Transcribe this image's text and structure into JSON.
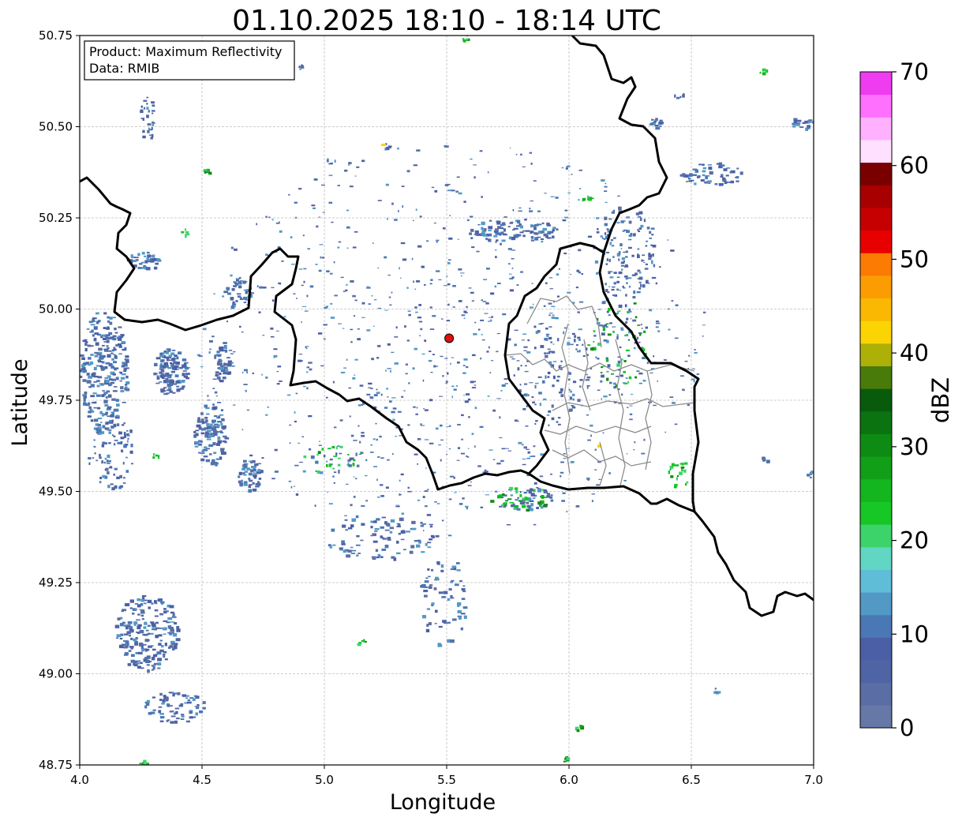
{
  "title": "01.10.2025 18:10 - 18:14 UTC",
  "info_box": {
    "line1": "Product: Maximum Reflectivity",
    "line2": "Data: RMIB"
  },
  "axes": {
    "xlabel": "Longitude",
    "ylabel": "Latitude",
    "xlim": [
      4.0,
      7.0
    ],
    "ylim": [
      48.75,
      50.75
    ],
    "xticks": [
      "4.0",
      "4.5",
      "5.0",
      "5.5",
      "6.0",
      "6.5",
      "7.0"
    ],
    "yticks": [
      "50.75",
      "50.50",
      "50.25",
      "50.00",
      "49.75",
      "49.50",
      "49.25",
      "49.00",
      "48.75"
    ],
    "grid": true
  },
  "radar_site": {
    "lon": 5.51,
    "lat": 49.92
  },
  "colorbar": {
    "label": "dBZ",
    "ticks": [
      "0",
      "10",
      "20",
      "30",
      "40",
      "50",
      "60",
      "70"
    ],
    "colors": [
      "#6678a8",
      "#5a6ea5",
      "#4f64a4",
      "#4a5fa5",
      "#4a78b5",
      "#5299c6",
      "#5fbdd8",
      "#61d6c2",
      "#3dd36b",
      "#16c725",
      "#13b61e",
      "#119f18",
      "#0d8b13",
      "#0b7410",
      "#095b0c",
      "#487b0a",
      "#adb007",
      "#fbd503",
      "#fbb803",
      "#fb9d02",
      "#fc7b03",
      "#e80000",
      "#c60000",
      "#a80000",
      "#7a0000",
      "#ffe0ff",
      "#ffb0ff",
      "#ff70ff",
      "#f03cf0"
    ]
  },
  "legend": {
    "site_color": "#e01010",
    "border_color": "#000000",
    "province_color": "#8c8c8c"
  }
}
